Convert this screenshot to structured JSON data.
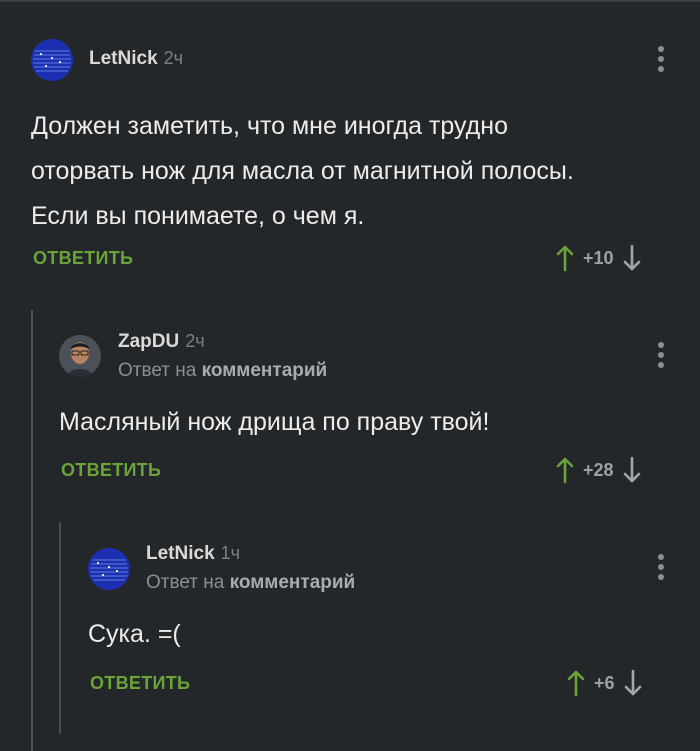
{
  "comments": [
    {
      "author": "LetNick",
      "time": "2ч",
      "reply_to": null,
      "text_lines": [
        "Должен заметить, что мне иногда трудно",
        "оторвать нож для масла от магнитной полосы.",
        "Если вы понимаете, о чем я."
      ],
      "reply_label": "ОТВЕТИТЬ",
      "score": "+10"
    },
    {
      "author": "ZapDU",
      "time": "2ч",
      "reply_to_prefix": "Ответ на",
      "reply_to_target": "комментарий",
      "text_lines": [
        "Масляный нож дрища по праву твой!"
      ],
      "reply_label": "ОТВЕТИТЬ",
      "score": "+28"
    },
    {
      "author": "LetNick",
      "time": "1ч",
      "reply_to_prefix": "Ответ на",
      "reply_to_target": "комментарий",
      "text_lines": [
        "Сука. =("
      ],
      "reply_label": "ОТВЕТИТЬ",
      "score": "+6"
    }
  ],
  "icons": {
    "upvote": "arrow-up-icon",
    "downvote": "arrow-down-icon",
    "menu": "more-vertical-icon"
  },
  "colors": {
    "background": "#24272a",
    "accent_green": "#6aa338",
    "text": "#ececec",
    "muted": "#8b8e92"
  }
}
